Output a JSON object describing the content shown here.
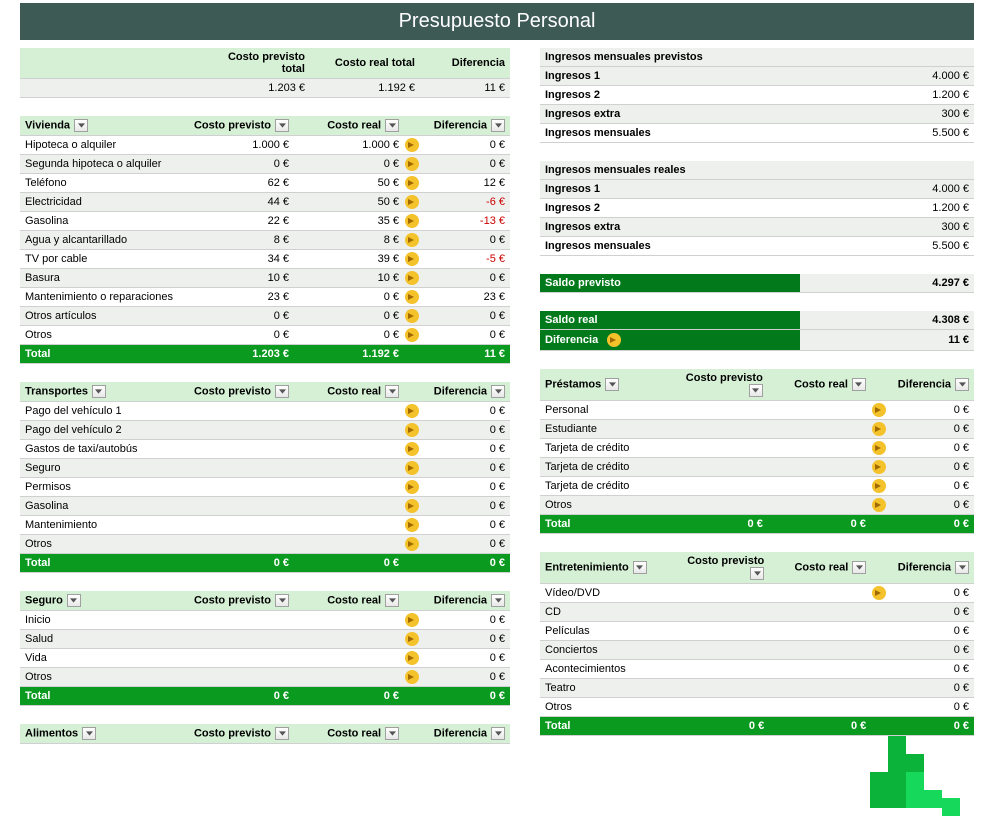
{
  "title": "Presupuesto Personal",
  "summary": {
    "headers": {
      "prev": "Costo previsto total",
      "real": "Costo real total",
      "diff": "Diferencia"
    },
    "prev": "1.203 €",
    "real": "1.192 €",
    "diff": "11 €"
  },
  "col_headers": {
    "prev": "Costo previsto",
    "real": "Costo real",
    "diff": "Diferencia"
  },
  "left_categories": [
    {
      "name": "Vivienda",
      "rows": [
        {
          "label": "Hipoteca o alquiler",
          "prev": "1.000 €",
          "real": "1.000 €",
          "diff": "0 €",
          "arrow": true
        },
        {
          "label": "Segunda hipoteca o alquiler",
          "prev": "0 €",
          "real": "0 €",
          "diff": "0 €",
          "arrow": true
        },
        {
          "label": "Teléfono",
          "prev": "62 €",
          "real": "50 €",
          "diff": "12 €",
          "arrow": true
        },
        {
          "label": "Electricidad",
          "prev": "44 €",
          "real": "50 €",
          "diff": "-6 €",
          "neg": true,
          "arrow": true
        },
        {
          "label": "Gasolina",
          "prev": "22 €",
          "real": "35 €",
          "diff": "-13 €",
          "neg": true,
          "arrow": true
        },
        {
          "label": "Agua y alcantarillado",
          "prev": "8 €",
          "real": "8 €",
          "diff": "0 €",
          "arrow": true
        },
        {
          "label": "TV por cable",
          "prev": "34 €",
          "real": "39 €",
          "diff": "-5 €",
          "neg": true,
          "arrow": true
        },
        {
          "label": "Basura",
          "prev": "10 €",
          "real": "10 €",
          "diff": "0 €",
          "arrow": true
        },
        {
          "label": "Mantenimiento o reparaciones",
          "prev": "23 €",
          "real": "0 €",
          "diff": "23 €",
          "arrow": true
        },
        {
          "label": "Otros artículos",
          "prev": "0 €",
          "real": "0 €",
          "diff": "0 €",
          "arrow": true
        },
        {
          "label": "Otros",
          "prev": "0 €",
          "real": "0 €",
          "diff": "0 €",
          "arrow": true
        }
      ],
      "total": {
        "label": "Total",
        "prev": "1.203 €",
        "real": "1.192 €",
        "diff": "11 €"
      }
    },
    {
      "name": "Transportes",
      "rows": [
        {
          "label": "Pago del vehículo 1",
          "prev": "",
          "real": "",
          "diff": "0 €",
          "arrow": true
        },
        {
          "label": "Pago del vehículo 2",
          "prev": "",
          "real": "",
          "diff": "0 €",
          "arrow": true
        },
        {
          "label": "Gastos de taxi/autobús",
          "prev": "",
          "real": "",
          "diff": "0 €",
          "arrow": true
        },
        {
          "label": "Seguro",
          "prev": "",
          "real": "",
          "diff": "0 €",
          "arrow": true
        },
        {
          "label": "Permisos",
          "prev": "",
          "real": "",
          "diff": "0 €",
          "arrow": true
        },
        {
          "label": "Gasolina",
          "prev": "",
          "real": "",
          "diff": "0 €",
          "arrow": true
        },
        {
          "label": "Mantenimiento",
          "prev": "",
          "real": "",
          "diff": "0 €",
          "arrow": true
        },
        {
          "label": "Otros",
          "prev": "",
          "real": "",
          "diff": "0 €",
          "arrow": true
        }
      ],
      "total": {
        "label": "Total",
        "prev": "0 €",
        "real": "0 €",
        "diff": "0 €"
      }
    },
    {
      "name": "Seguro",
      "rows": [
        {
          "label": "Inicio",
          "prev": "",
          "real": "",
          "diff": "0 €",
          "arrow": true
        },
        {
          "label": "Salud",
          "prev": "",
          "real": "",
          "diff": "0 €",
          "arrow": true
        },
        {
          "label": "Vida",
          "prev": "",
          "real": "",
          "diff": "0 €",
          "arrow": true
        },
        {
          "label": "Otros",
          "prev": "",
          "real": "",
          "diff": "0 €",
          "arrow": true
        }
      ],
      "total": {
        "label": "Total",
        "prev": "0 €",
        "real": "0 €",
        "diff": "0 €"
      }
    },
    {
      "name": "Alimentos",
      "rows": [],
      "header_only": true
    }
  ],
  "income_prev": {
    "title": "Ingresos mensuales previstos",
    "rows": [
      {
        "label": "Ingresos 1",
        "val": "4.000 €"
      },
      {
        "label": "Ingresos 2",
        "val": "1.200 €"
      },
      {
        "label": "Ingresos extra",
        "val": "300 €"
      },
      {
        "label": "Ingresos mensuales",
        "val": "5.500 €"
      }
    ]
  },
  "income_real": {
    "title": "Ingresos mensuales reales",
    "rows": [
      {
        "label": "Ingresos 1",
        "val": "4.000 €"
      },
      {
        "label": "Ingresos 2",
        "val": "1.200 €"
      },
      {
        "label": "Ingresos extra",
        "val": "300 €"
      },
      {
        "label": "Ingresos mensuales",
        "val": "5.500 €"
      }
    ]
  },
  "balance": {
    "rows": [
      {
        "label": "Saldo previsto",
        "val": "4.297 €",
        "dark": true
      },
      {
        "label": "",
        "val": "",
        "spacer": true
      },
      {
        "label": "Saldo real",
        "val": "4.308 €",
        "dark": true
      },
      {
        "label": "Diferencia",
        "val": "11 €",
        "dark": true,
        "arrow": true
      }
    ]
  },
  "right_categories": [
    {
      "name": "Préstamos",
      "rows": [
        {
          "label": "Personal",
          "diff": "0 €",
          "arrow": true
        },
        {
          "label": "Estudiante",
          "diff": "0 €",
          "arrow": true
        },
        {
          "label": "Tarjeta de crédito",
          "diff": "0 €",
          "arrow": true
        },
        {
          "label": "Tarjeta de crédito",
          "diff": "0 €",
          "arrow": true
        },
        {
          "label": "Tarjeta de crédito",
          "diff": "0 €",
          "arrow": true
        },
        {
          "label": "Otros",
          "diff": "0 €",
          "arrow": true
        }
      ],
      "total": {
        "label": "Total",
        "prev": "0 €",
        "real": "0 €",
        "diff": "0 €"
      }
    },
    {
      "name": "Entretenimiento",
      "rows": [
        {
          "label": "Vídeo/DVD",
          "diff": "0 €",
          "arrow": true
        },
        {
          "label": "CD",
          "diff": "0 €"
        },
        {
          "label": "Películas",
          "diff": "0 €"
        },
        {
          "label": "Conciertos",
          "diff": "0 €"
        },
        {
          "label": "Acontecimientos",
          "diff": "0 €"
        },
        {
          "label": "Teatro",
          "diff": "0 €"
        },
        {
          "label": "Otros",
          "diff": "0 €"
        }
      ],
      "total": {
        "label": "Total",
        "prev": "0 €",
        "real": "0 €",
        "diff": "0 €"
      }
    }
  ]
}
